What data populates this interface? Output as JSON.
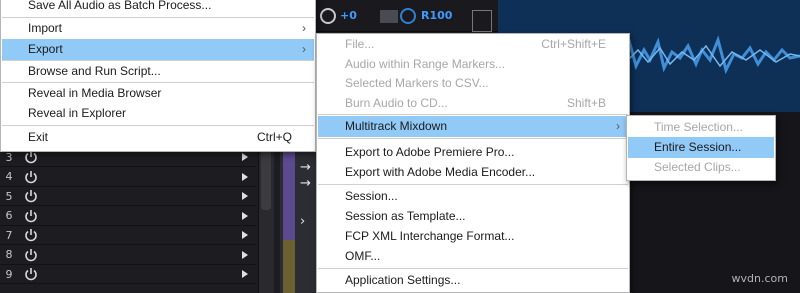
{
  "file_menu": {
    "items": [
      {
        "label": "Save All Audio as Batch Process...",
        "shortcut": "",
        "submenu": false
      },
      {
        "label": "Import",
        "shortcut": "",
        "submenu": true
      },
      {
        "label": "Export",
        "shortcut": "",
        "submenu": true
      },
      {
        "label": "Browse and Run Script...",
        "shortcut": "",
        "submenu": false
      },
      {
        "label": "Reveal in Media Browser",
        "shortcut": "",
        "submenu": false
      },
      {
        "label": "Reveal in Explorer",
        "shortcut": "",
        "submenu": false
      },
      {
        "label": "Exit",
        "shortcut": "Ctrl+Q",
        "submenu": false
      }
    ]
  },
  "export_menu": {
    "items": [
      {
        "label": "File...",
        "shortcut": "Ctrl+Shift+E"
      },
      {
        "label": "Audio within Range Markers..."
      },
      {
        "label": "Selected Markers to CSV..."
      },
      {
        "label": "Burn Audio to CD...",
        "shortcut": "Shift+B"
      },
      {
        "label": "Multitrack Mixdown"
      },
      {
        "label": "Export to Adobe Premiere Pro..."
      },
      {
        "label": "Export with Adobe Media Encoder..."
      },
      {
        "label": "Session..."
      },
      {
        "label": "Session as Template..."
      },
      {
        "label": "FCP XML Interchange Format..."
      },
      {
        "label": "OMF..."
      },
      {
        "label": "Application Settings..."
      }
    ]
  },
  "multitrack_menu": {
    "items": [
      {
        "label": "Time Selection..."
      },
      {
        "label": "Entire Session..."
      },
      {
        "label": "Selected Clips..."
      }
    ]
  },
  "track_header": {
    "volume_value": "+0",
    "record_label": "R100"
  },
  "tracks": [
    "3",
    "4",
    "5",
    "6",
    "7",
    "8",
    "9"
  ],
  "watermark": "wvdn.com",
  "colors": {
    "highlight": "#91c9f7",
    "waveform": "#3f8fd8",
    "knob_blue": "#2f7fd6"
  }
}
